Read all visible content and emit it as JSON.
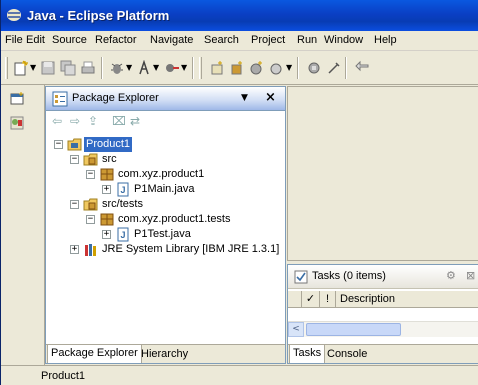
{
  "window": {
    "title": "Java - Eclipse Platform"
  },
  "menu": [
    "File",
    "Edit",
    "Source",
    "Refactor",
    "Navigate",
    "Search",
    "Project",
    "Run",
    "Window",
    "Help"
  ],
  "package_explorer": {
    "title": "Package Explorer",
    "tree": [
      {
        "label": "Product1",
        "selected": true
      },
      {
        "label": "src"
      },
      {
        "label": "com.xyz.product1"
      },
      {
        "label": "P1Main.java"
      },
      {
        "label": "src/tests"
      },
      {
        "label": "com.xyz.product1.tests"
      },
      {
        "label": "P1Test.java"
      },
      {
        "label": "JRE System Library [IBM JRE 1.3.1]"
      }
    ],
    "tabs": [
      "Package Explorer",
      "Hierarchy"
    ]
  },
  "tasks": {
    "title": "Tasks (0 items)",
    "columns": [
      "✓",
      "!",
      "Description"
    ],
    "tabs": [
      "Tasks",
      "Console"
    ]
  },
  "status": {
    "text": "Product1"
  },
  "colors": {
    "title_bar": "#0a3fc4",
    "selection": "#316ac5",
    "chrome": "#ece9d8"
  }
}
